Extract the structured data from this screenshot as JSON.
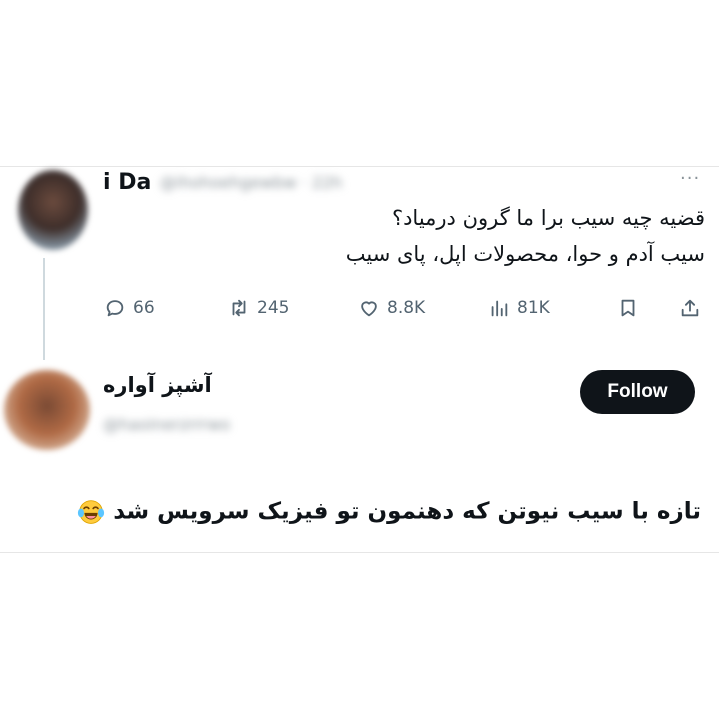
{
  "tweet": {
    "author_name": "i Da",
    "author_handle": "@ihohoehgewbw · 22h",
    "more_label": "···",
    "text_line1": "قضیه چیه سیب برا ما گرون درمیاد؟",
    "text_line2": "سیب آدم و حوا، محصولات اپل، پای سیب",
    "replies": "66",
    "reposts": "245",
    "likes": "8.8K",
    "views": "81K"
  },
  "reply": {
    "author_name": "آشپز آواره",
    "author_handle": "@haoinerzrrrwo",
    "follow_label": "Follow",
    "text": "تازه با سیب نیوتن که دهنمون تو فیزیک سرویس شد",
    "emoji": "face-with-tears-of-joy-emoji"
  },
  "icons": {
    "reply": "reply-icon",
    "repost": "repost-icon",
    "like": "heart-icon",
    "views": "views-chart-icon",
    "bookmark": "bookmark-icon",
    "share": "share-icon"
  }
}
